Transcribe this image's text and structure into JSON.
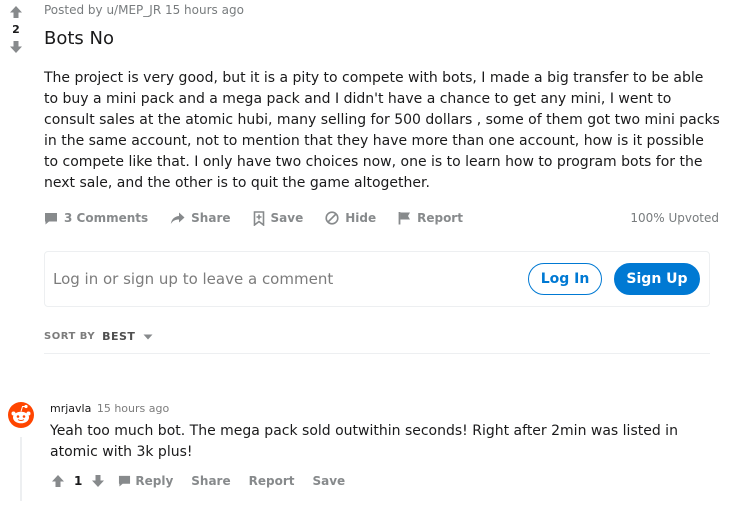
{
  "post": {
    "vote_count": "2",
    "meta": "Posted by u/MEP_JR 15 hours ago",
    "title": "Bots No",
    "body": "The project is very good, but it is a pity to compete with bots, I made a big transfer to be able to buy a mini pack and a mega pack and I didn't have a chance to get any mini, I went to consult sales at the atomic hubi, many selling for 500 dollars , some of them got two mini packs in the same account, not to mention that they have more than one account, how is it possible to compete like that. I only have two choices now, one is to learn how to program bots for the next sale, and the other is to quit the game altogether.",
    "actions": {
      "comments": "3 Comments",
      "share": "Share",
      "save": "Save",
      "hide": "Hide",
      "report": "Report"
    },
    "upvoted": "100% Upvoted"
  },
  "login_prompt": {
    "text": "Log in or sign up to leave a comment",
    "login_label": "Log In",
    "signup_label": "Sign Up"
  },
  "sort": {
    "label": "SORT BY",
    "value": "BEST"
  },
  "comment": {
    "author": "mrjavla",
    "time": "15 hours ago",
    "body": "Yeah too much bot. The mega pack sold outwithin seconds! Right after 2min was listed in atomic with 3k plus!",
    "vote_count": "1",
    "actions": {
      "reply": "Reply",
      "share": "Share",
      "report": "Report",
      "save": "Save"
    }
  },
  "colors": {
    "accent": "#0079d3",
    "muted": "#878a8c",
    "avatar": "#ff4500"
  }
}
